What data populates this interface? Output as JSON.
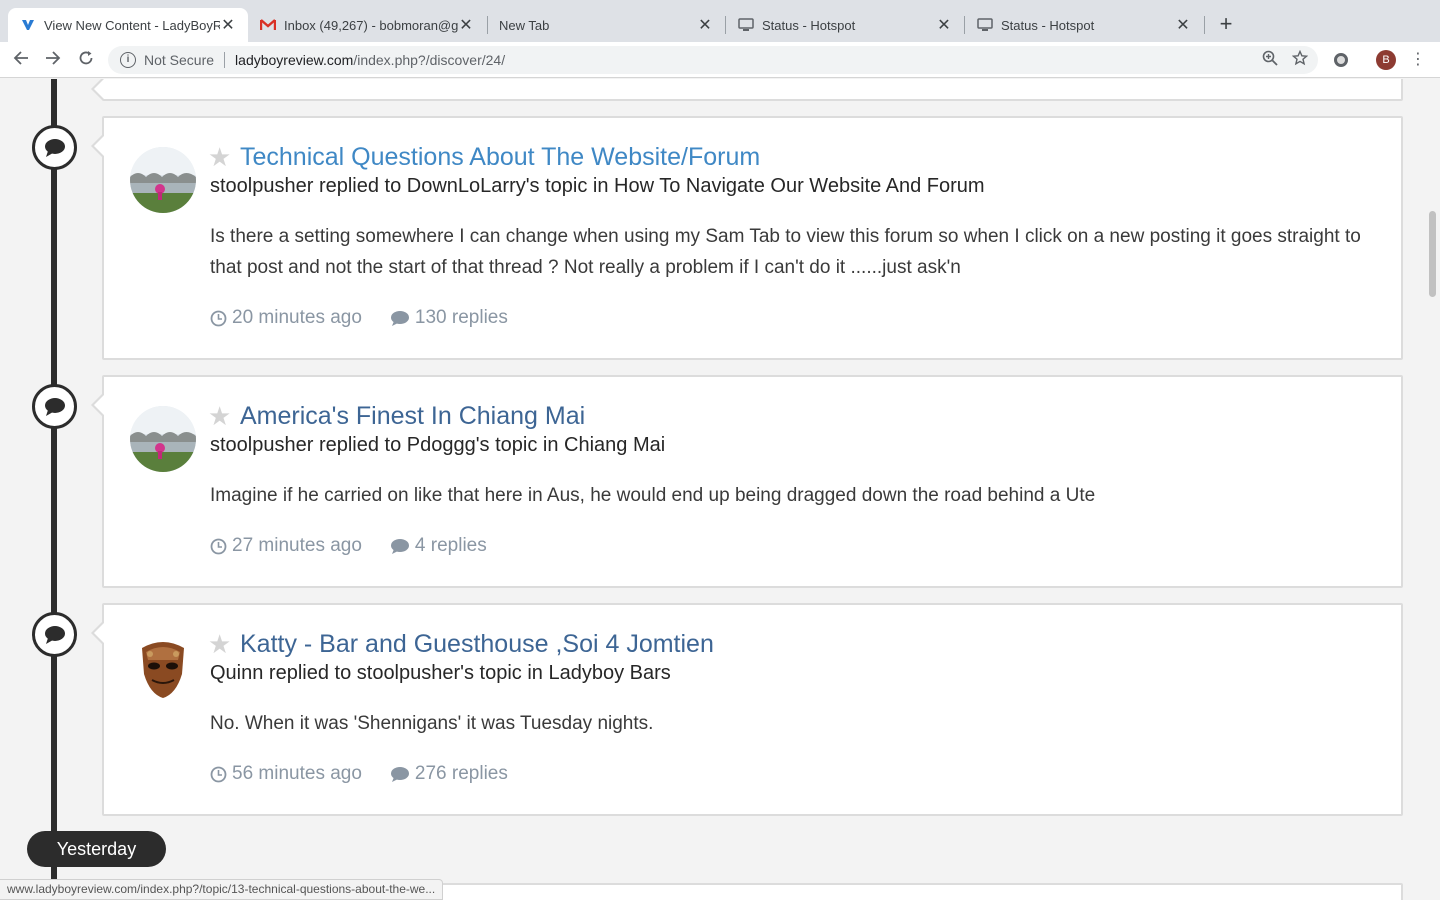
{
  "browser": {
    "tabs": [
      {
        "title": "View New Content - LadyBoyR",
        "icon": "ladyboyreview-favicon",
        "active": true
      },
      {
        "title": "Inbox (49,267) - bobmoran@g",
        "icon": "gmail-favicon",
        "active": false
      },
      {
        "title": "New Tab",
        "icon": "",
        "active": false
      },
      {
        "title": "Status - Hotspot",
        "icon": "monitor-favicon",
        "active": false
      },
      {
        "title": "Status - Hotspot",
        "icon": "monitor-favicon",
        "active": false
      }
    ],
    "address": {
      "security_label": "Not Secure",
      "host": "ladyboyreview.com",
      "path": "/index.php?/discover/24/"
    },
    "profile_initial": "B"
  },
  "feed": {
    "items": [
      {
        "title": "Technical Questions About The Website/Forum",
        "hovered": true,
        "byline": "stoolpusher replied to DownLoLarry's topic in How To Navigate Our Website And Forum",
        "snippet": "Is there a setting somewhere I can change when using my Sam Tab to view this forum so when I click on a new posting it goes straight to that post and not the start of that thread ? Not really a problem if I can't do it ......just ask'n",
        "time": "20 minutes ago",
        "replies": "130 replies"
      },
      {
        "title": "America's Finest In Chiang Mai",
        "hovered": false,
        "byline": "stoolpusher replied to Pdoggg's topic in Chiang Mai",
        "snippet": "Imagine if he carried on like that here in Aus, he would end up being dragged down the road behind a Ute",
        "time": "27 minutes ago",
        "replies": "4 replies"
      },
      {
        "title": "Katty - Bar and Guesthouse ,Soi 4 Jomtien",
        "hovered": false,
        "byline": "Quinn replied to stoolpusher's topic in Ladyboy Bars",
        "snippet": "No. When it was 'Shennigans' it was Tuesday nights.",
        "time": "56 minutes ago",
        "replies": "276 replies"
      }
    ],
    "divider_label": "Yesterday"
  },
  "status_bar": {
    "url": "www.ladyboyreview.com/index.php?/topic/13-technical-questions-about-the-we..."
  },
  "colors": {
    "title_link": "#3f88c5",
    "title": "#3d6594",
    "meta": "#8a96a3",
    "timeline": "#2c2c2c"
  }
}
